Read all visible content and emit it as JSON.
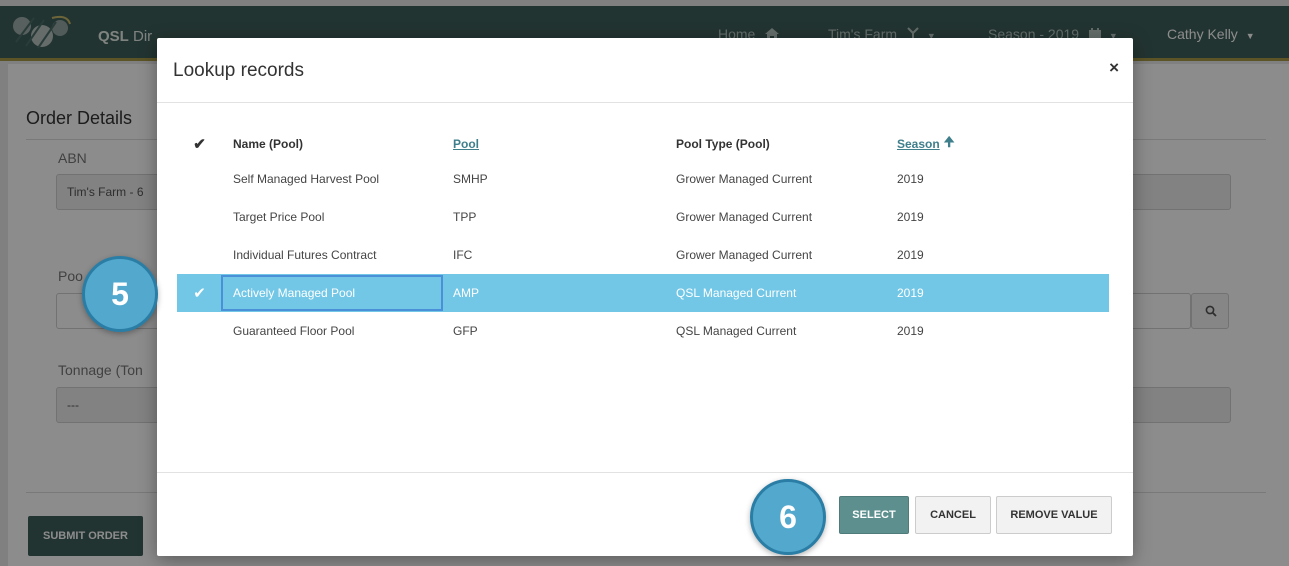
{
  "app": {
    "brand_short": "QSL",
    "brand_rest": " Dir",
    "nav_home": "Home",
    "nav_farm": "Tim's Farm",
    "nav_season": "Season - 2019",
    "nav_user": "Cathy Kelly"
  },
  "page": {
    "title": "Order Details",
    "abn_label": "ABN",
    "abn_value": "Tim's Farm - 6",
    "pool_label": "Poo",
    "tonnage_label": "Tonnage (Ton",
    "tonnage_value": "---",
    "submit_label": "SUBMIT ORDER"
  },
  "modal": {
    "title": "Lookup records",
    "close_symbol": "×",
    "columns": {
      "check": "✔",
      "name": "Name (Pool)",
      "pool": "Pool",
      "pool_type": "Pool Type (Pool)",
      "season": "Season"
    },
    "rows": [
      {
        "check": "",
        "name": "Self Managed Harvest Pool",
        "pool": "SMHP",
        "pool_type": "Grower Managed Current",
        "season": "2019"
      },
      {
        "check": "",
        "name": "Target Price Pool",
        "pool": "TPP",
        "pool_type": "Grower Managed Current",
        "season": "2019"
      },
      {
        "check": "",
        "name": "Individual Futures Contract",
        "pool": "IFC",
        "pool_type": "Grower Managed Current",
        "season": "2019"
      },
      {
        "check": "✔",
        "name": "Actively Managed Pool",
        "pool": "AMP",
        "pool_type": "QSL Managed Current",
        "season": "2019"
      },
      {
        "check": "",
        "name": "Guaranteed Floor Pool",
        "pool": "GFP",
        "pool_type": "QSL Managed Current",
        "season": "2019"
      }
    ],
    "buttons": {
      "select": "SELECT",
      "cancel": "CANCEL",
      "remove": "REMOVE VALUE"
    }
  },
  "callouts": {
    "step_a": "5",
    "step_b": "6"
  },
  "colors": {
    "topbar": "#3f5f5a",
    "selected_row": "#72c7e7",
    "select_button": "#5e8f8f",
    "callout": "#53a8cd"
  },
  "icons": {
    "home": "home-icon",
    "farm": "wheat-icon",
    "season": "calendar-icon",
    "search": "search-icon",
    "sort": "sort-up-arrow-icon"
  }
}
